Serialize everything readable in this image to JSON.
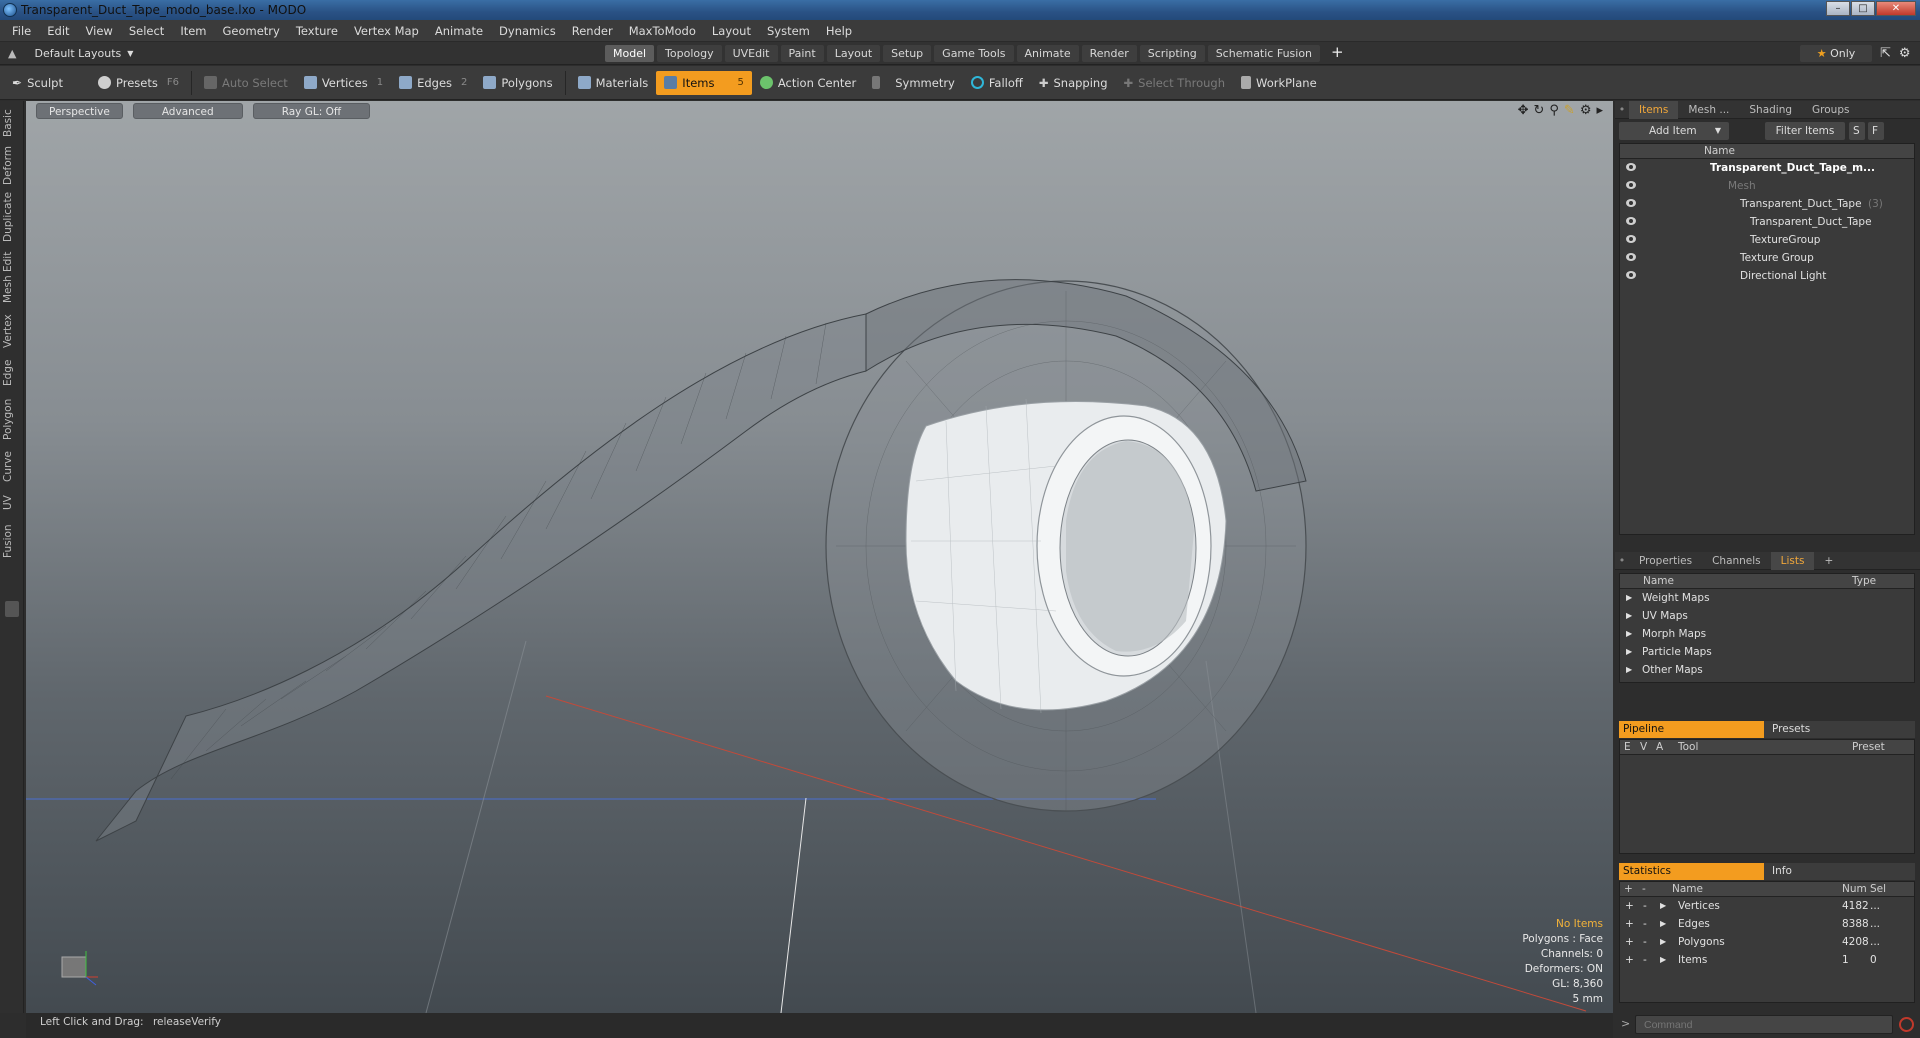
{
  "window": {
    "title": "Transparent_Duct_Tape_modo_base.lxo - MODO"
  },
  "menu": [
    "File",
    "Edit",
    "View",
    "Select",
    "Item",
    "Geometry",
    "Texture",
    "Vertex Map",
    "Animate",
    "Dynamics",
    "Render",
    "MaxToModo",
    "Layout",
    "System",
    "Help"
  ],
  "layout": {
    "preset": "Default Layouts",
    "tabs": [
      "Model",
      "Topology",
      "UVEdit",
      "Paint",
      "Layout",
      "Setup",
      "Game Tools",
      "Animate",
      "Render",
      "Scripting",
      "Schematic Fusion"
    ],
    "active_tab": "Model",
    "plus": "+",
    "only": "Only"
  },
  "toolbar": {
    "sculpt": "Sculpt",
    "presets": "Presets",
    "presets_key": "F6",
    "auto_select": "Auto Select",
    "vertices": "Vertices",
    "vertices_num": "1",
    "edges": "Edges",
    "edges_num": "2",
    "polygons": "Polygons",
    "materials": "Materials",
    "items": "Items",
    "items_num": "5",
    "action_center": "Action Center",
    "symmetry": "Symmetry",
    "falloff": "Falloff",
    "snapping": "Snapping",
    "select_through": "Select Through",
    "workplane": "WorkPlane"
  },
  "left_tabs": [
    "Basic",
    "Deform",
    "Duplicate",
    "Mesh Edit",
    "Vertex",
    "Edge",
    "Polygon",
    "Curve",
    "UV",
    "Fusion"
  ],
  "viewport": {
    "view": "Perspective",
    "shading": "Advanced",
    "raygl": "Ray GL: Off",
    "info": {
      "no_items": "No Items",
      "polygons": "Polygons : Face",
      "channels": "Channels: 0",
      "deformers": "Deformers: ON",
      "gl": "GL: 8,360",
      "unit": "5 mm"
    }
  },
  "status": {
    "hint": "Left Click and Drag:",
    "action": "releaseVerify"
  },
  "items_panel": {
    "tabs": [
      "Items",
      "Mesh ...",
      "Shading",
      "Groups"
    ],
    "add_item": "Add Item",
    "filter": "Filter Items",
    "s": "S",
    "f": "F",
    "col_name": "Name",
    "tree": [
      {
        "label": "Transparent_Duct_Tape_m...",
        "bold": true
      },
      {
        "label": "Mesh",
        "dim": true
      },
      {
        "label": "Transparent_Duct_Tape",
        "suffix": "(3)"
      },
      {
        "label": "Transparent_Duct_Tape"
      },
      {
        "label": "TextureGroup"
      },
      {
        "label": "Texture Group"
      },
      {
        "label": "Directional Light"
      }
    ]
  },
  "props_panel": {
    "tabs": [
      "Properties",
      "Channels",
      "Lists"
    ],
    "plus": "+",
    "col_name": "Name",
    "col_type": "Type",
    "lists": [
      "Weight Maps",
      "UV Maps",
      "Morph Maps",
      "Particle Maps",
      "Other Maps"
    ]
  },
  "pipeline": {
    "tab_a": "Pipeline",
    "tab_b": "Presets",
    "cols": [
      "E",
      "V",
      "A",
      "Tool",
      "Preset"
    ]
  },
  "statistics": {
    "tab_a": "Statistics",
    "tab_b": "Info",
    "col_plus": "+",
    "col_minus": "-",
    "col_name": "Name",
    "col_num": "Num",
    "col_sel": "Sel",
    "rows": [
      {
        "name": "Vertices",
        "num": "4182",
        "sel": "..."
      },
      {
        "name": "Edges",
        "num": "8388",
        "sel": "..."
      },
      {
        "name": "Polygons",
        "num": "4208",
        "sel": "..."
      },
      {
        "name": "Items",
        "num": "1",
        "sel": "0"
      }
    ]
  },
  "command": {
    "placeholder": "Command"
  }
}
